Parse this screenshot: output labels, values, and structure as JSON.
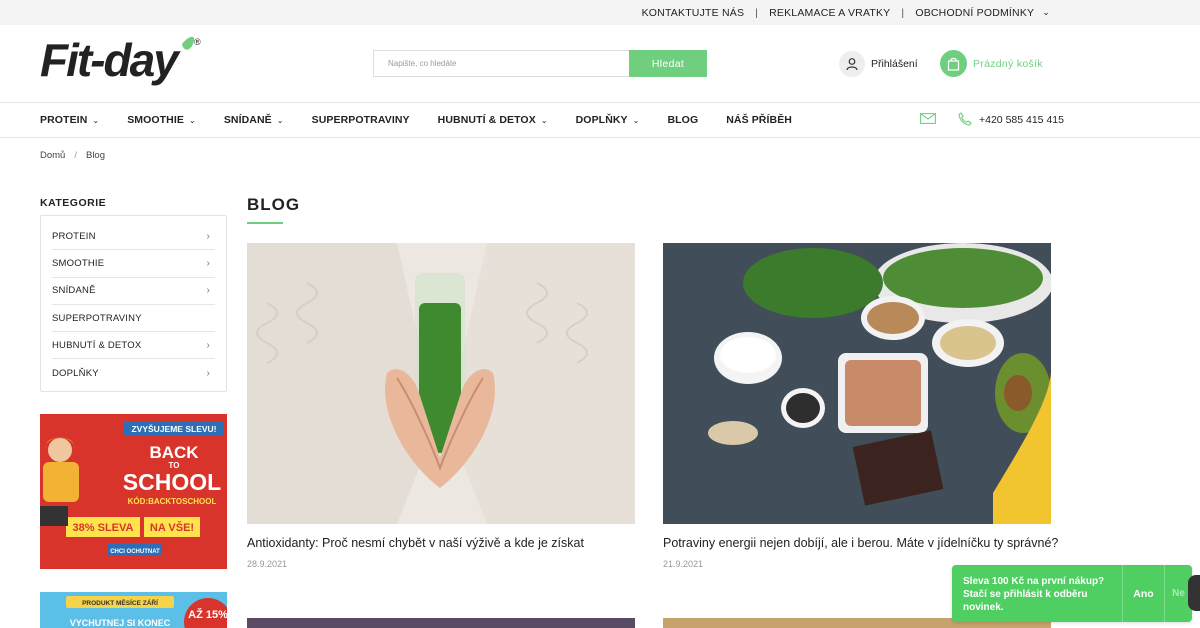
{
  "topbar": {
    "links": [
      "KONTAKTUJTE NÁS",
      "REKLAMACE A VRATKY",
      "OBCHODNÍ PODMÍNKY"
    ],
    "separator": "|"
  },
  "header": {
    "logo_text": "Fit·day",
    "logo_reg": "®",
    "search_placeholder": "Napište, co hledáte",
    "search_button": "Hledat",
    "login_label": "Přihlášení",
    "cart_label": "Prázdný košík"
  },
  "nav": {
    "items": [
      {
        "label": "PROTEIN",
        "dropdown": true
      },
      {
        "label": "SMOOTHIE",
        "dropdown": true
      },
      {
        "label": "SNÍDANĚ",
        "dropdown": true
      },
      {
        "label": "SUPERPOTRAVINY",
        "dropdown": false
      },
      {
        "label": "HUBNUTÍ & DETOX",
        "dropdown": true
      },
      {
        "label": "DOPLŇKY",
        "dropdown": true
      },
      {
        "label": "BLOG",
        "dropdown": false
      },
      {
        "label": "NÁŠ PŘÍBĚH",
        "dropdown": false
      }
    ],
    "phone": "+420 585 415 415"
  },
  "breadcrumb": {
    "home": "Domů",
    "separator": "/",
    "current": "Blog"
  },
  "sidebar": {
    "title": "KATEGORIE",
    "categories": [
      {
        "label": "PROTEIN",
        "arrow": true
      },
      {
        "label": "SMOOTHIE",
        "arrow": true
      },
      {
        "label": "SNÍDANĚ",
        "arrow": true
      },
      {
        "label": "SUPERPOTRAVINY",
        "arrow": false
      },
      {
        "label": "HUBNUTÍ & DETOX",
        "arrow": true
      },
      {
        "label": "DOPLŇKY",
        "arrow": true
      }
    ],
    "banner1": {
      "top": "ZVYŠUJEME SLEVU!",
      "line1": "BACK",
      "line2": "TO",
      "line3": "SCHOOL",
      "code": "KÓD:BACKTOSCHOOL",
      "discount": "38% SLEVA",
      "suffix": "NA VŠE!",
      "cta": "CHCI OCHUTNAT"
    },
    "banner2": {
      "text": "PRODUKT MĚSÍCE ZÁŘÍ",
      "big": "AŽ 15%",
      "sub": "VYCHUTNEJ SI KONEC"
    }
  },
  "main": {
    "title": "BLOG",
    "posts": [
      {
        "title": "Antioxidanty: Proč nesmí chybět v naší výživě a kde je získat",
        "date": "28.9.2021"
      },
      {
        "title": "Potraviny energii nejen dobíjí, ale i berou. Máte v jídelníčku ty správné?",
        "date": "21.9.2021"
      }
    ]
  },
  "popup": {
    "message": "Sleva 100 Kč na první nákup? Stačí se přihlásit k odběru novinek.",
    "yes": "Ano",
    "no": "Ne"
  },
  "colors": {
    "accent": "#6fcf7f",
    "popup": "#4fcf62",
    "banner_red": "#d8342c"
  }
}
